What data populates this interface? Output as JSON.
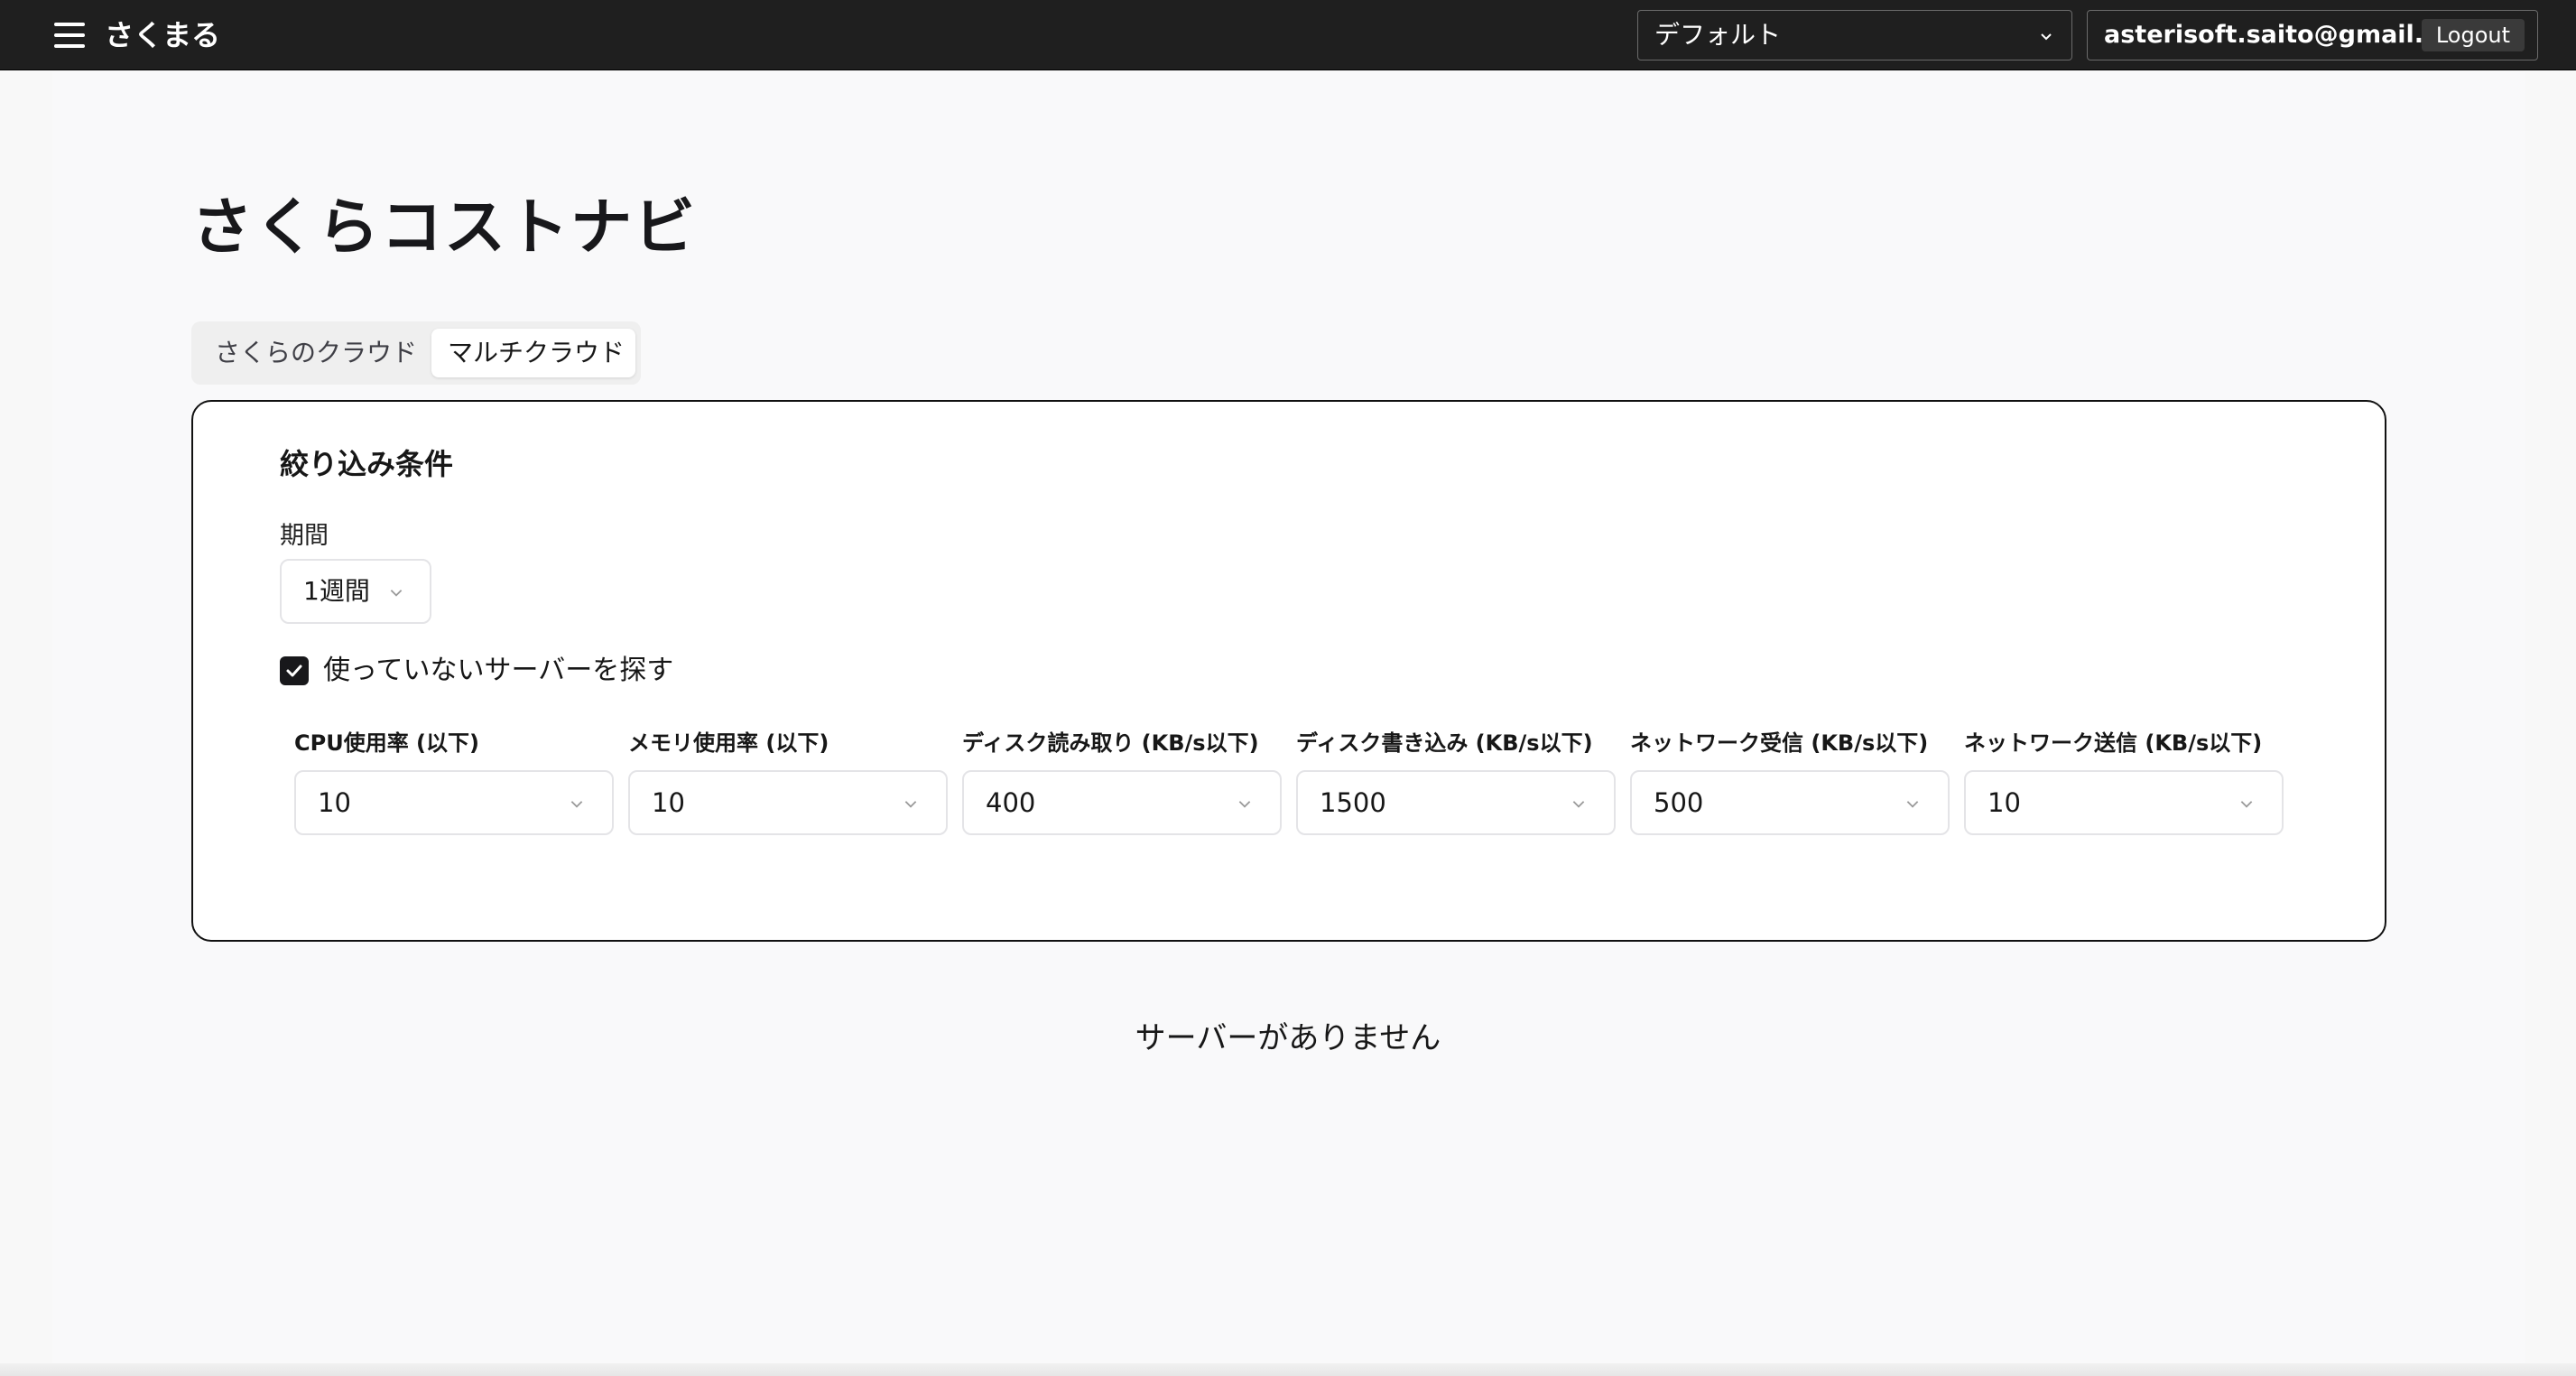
{
  "header": {
    "app_name": "さくまる",
    "project_selector": {
      "value": "デフォルト"
    },
    "user_email": "asterisoft.saito@gmail.com",
    "logout_label": "Logout"
  },
  "page": {
    "title": "さくらコストナビ",
    "tabs": [
      {
        "label": "さくらのクラウド",
        "active": false
      },
      {
        "label": "マルチクラウド",
        "active": true
      }
    ]
  },
  "filter": {
    "title": "絞り込み条件",
    "period_label": "期間",
    "period_value": "1週間",
    "unused_checkbox": {
      "label": "使っていないサーバーを探す",
      "checked": true
    },
    "metrics": [
      {
        "label": "CPU使用率 (以下)",
        "value": "10"
      },
      {
        "label": "メモリ使用率 (以下)",
        "value": "10"
      },
      {
        "label": "ディスク読み取り (KB/s以下)",
        "value": "400"
      },
      {
        "label": "ディスク書き込み (KB/s以下)",
        "value": "1500"
      },
      {
        "label": "ネットワーク受信 (KB/s以下)",
        "value": "500"
      },
      {
        "label": "ネットワーク送信 (KB/s以下)",
        "value": "10"
      }
    ]
  },
  "empty_message": "サーバーがありません",
  "icons": {
    "menu": "hamburger-menu-icon",
    "chevron": "chevron-down-icon",
    "check": "checkmark-icon"
  },
  "colors": {
    "topbar": "#1f1f1f",
    "card_border": "#111111",
    "checkbox": "#18181b"
  }
}
